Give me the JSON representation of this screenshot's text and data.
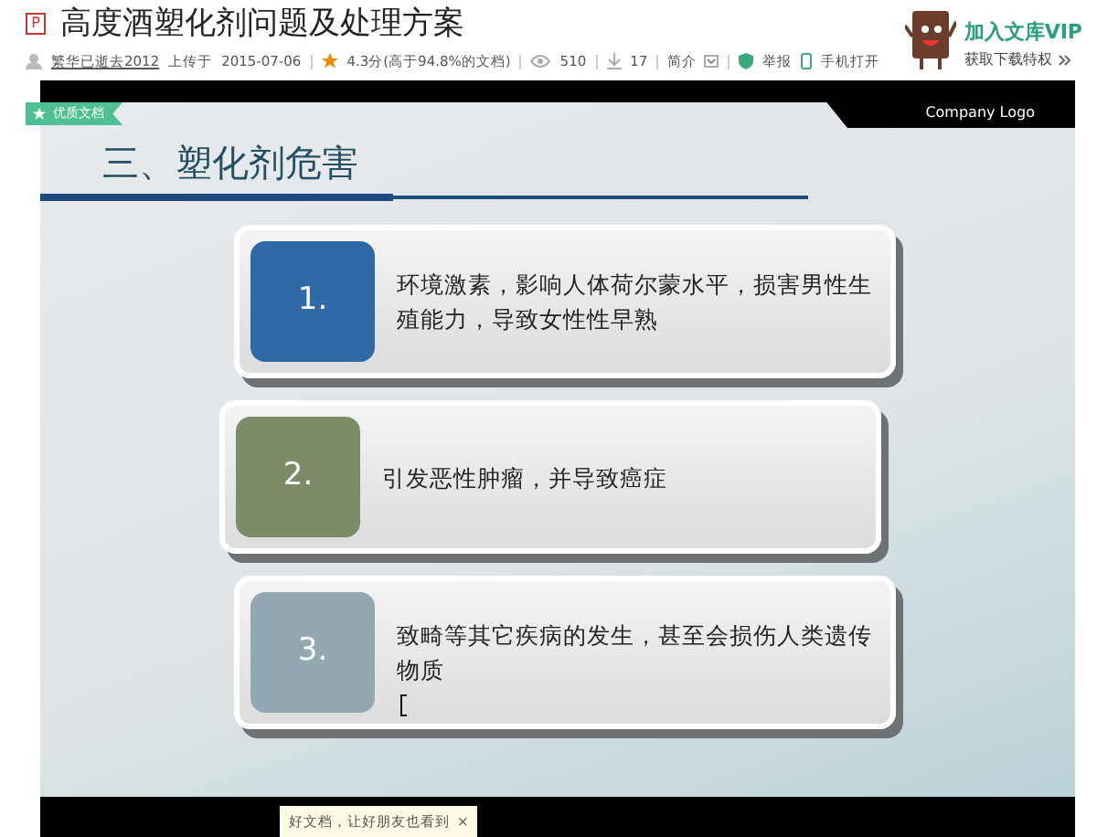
{
  "document": {
    "file_type": "P",
    "title": "高度酒塑化剂问题及处理方案",
    "uploader": "繁华已逝去2012",
    "uploaded_label": "上传于",
    "date": "2015-07-06",
    "rating": "4.3分(高于94.8%的文档)",
    "views": "510",
    "downloads": "17",
    "intro": "简介",
    "report": "举报",
    "mobile": "手机打开"
  },
  "vip": {
    "title": "加入文库VIP",
    "subtitle": "获取下载特权"
  },
  "badge": "优质文档",
  "slide": {
    "logo": "Company Logo",
    "heading": "三、塑化剂危害",
    "items": [
      {
        "number": "1.",
        "text": "环境激素，影响人体荷尔蒙水平，损害男性生殖能力，导致女性性早熟",
        "color": "#2f6aa6"
      },
      {
        "number": "2.",
        "text": "引发恶性肿瘤，并导致癌症",
        "color": "#7d8c68"
      },
      {
        "number": "3.",
        "text": "致畸等其它疾病的发生，甚至会损伤人类遗传物质",
        "color": "#93a9b2"
      }
    ]
  },
  "share_tip": {
    "text": "好文档，让好朋友也看到",
    "close": "×"
  }
}
